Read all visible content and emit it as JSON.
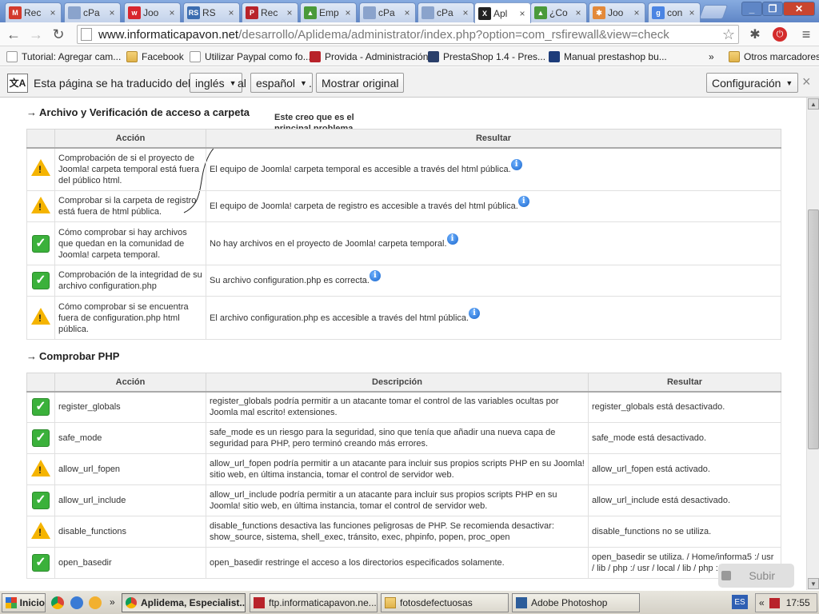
{
  "browser": {
    "tabs": [
      {
        "title": "Rec",
        "icon": "gmail-icon",
        "color": "#d33a2c",
        "glyph": "M"
      },
      {
        "title": "cPa",
        "icon": "page-icon",
        "color": "#8aa3cc",
        "glyph": ""
      },
      {
        "title": "Joo",
        "icon": "joomla-icon",
        "color": "#d8262e",
        "glyph": "w"
      },
      {
        "title": "RS",
        "icon": "rsfirewall-icon",
        "color": "#3c6db0",
        "glyph": "RS"
      },
      {
        "title": "Rec",
        "icon": "provida-icon",
        "color": "#b8232a",
        "glyph": "P"
      },
      {
        "title": "Emp",
        "icon": "drive-icon",
        "color": "#4a9a3a",
        "glyph": "▲"
      },
      {
        "title": "cPa",
        "icon": "page-icon",
        "color": "#8aa3cc",
        "glyph": ""
      },
      {
        "title": "cPa",
        "icon": "page-icon",
        "color": "#8aa3cc",
        "glyph": ""
      },
      {
        "title": "Apl",
        "icon": "joomla-icon",
        "color": "#222222",
        "glyph": "X"
      },
      {
        "title": "¿Co",
        "icon": "drive-icon",
        "color": "#4a9a3a",
        "glyph": "▲"
      },
      {
        "title": "Joo",
        "icon": "joomla-icon",
        "color": "#e3893a",
        "glyph": "✱"
      },
      {
        "title": "con",
        "icon": "google-icon",
        "color": "#4a84e3",
        "glyph": "g"
      }
    ],
    "close_glyph": "×",
    "url_host": "www.informaticapavon.net",
    "url_path": "/desarrollo/Aplidema/administrator/index.php?option=com_rsfirewall&view=check",
    "nav": {
      "back": "←",
      "forward": "→",
      "reload": "↻",
      "star": "☆",
      "menu": "≡"
    }
  },
  "bookmarks": [
    {
      "label": "Tutorial: Agregar cam...",
      "icon": "page-icon"
    },
    {
      "label": "Facebook",
      "icon": "folder-icon"
    },
    {
      "label": "Utilizar Paypal como fo...",
      "icon": "page-icon"
    },
    {
      "label": "Provida - Administración",
      "icon": "provida-icon"
    },
    {
      "label": "PrestaShop 1.4 - Pres...",
      "icon": "prestashop-icon"
    },
    {
      "label": "Manual prestashop bu...",
      "icon": "scribd-icon"
    }
  ],
  "bookmarks_overflow": "»",
  "other_bookmarks": "Otros marcadores",
  "translate": {
    "text": "Esta página se ha traducido del",
    "from_lang": "inglés",
    "al": "al",
    "to_lang": "español",
    "period": ".",
    "show_original": "Mostrar original",
    "config": "Configuración",
    "close": "×"
  },
  "annotation": "Este creo que es el\nprincipal problema",
  "section1": {
    "arrow": "→",
    "title": "Archivo y Verificación de acceso a carpeta",
    "col_action": "Acción",
    "col_result": "Resultar",
    "rows": [
      {
        "status": "warning",
        "action": "Comprobación de si el proyecto de Joomla! carpeta temporal está fuera del público html.",
        "result": "El equipo de Joomla! carpeta temporal es accesible a través del html pública."
      },
      {
        "status": "warning",
        "action": "Comprobar si la carpeta de registro está fuera de html pública.",
        "result": "El equipo de Joomla! carpeta de registro es accesible a través del html pública."
      },
      {
        "status": "ok",
        "action": "Cómo comprobar si hay archivos que quedan en la comunidad de Joomla! carpeta temporal.",
        "result": "No hay archivos en el proyecto de Joomla! carpeta temporal."
      },
      {
        "status": "ok",
        "action": "Comprobación de la integridad de su archivo configuration.php",
        "result": "Su archivo configuration.php es correcta."
      },
      {
        "status": "warning",
        "action": "Cómo comprobar si se encuentra fuera de configuration.php html pública.",
        "result": "El archivo configuration.php es accesible a través del html pública."
      }
    ]
  },
  "section2": {
    "arrow": "→",
    "title": "Comprobar PHP",
    "col_action": "Acción",
    "col_desc": "Descripción",
    "col_result": "Resultar",
    "rows": [
      {
        "status": "ok",
        "action": "register_globals",
        "desc": "register_globals podría permitir a un atacante tomar el control de las variables ocultas por Joomla mal escrito! extensiones.",
        "result": "register_globals está desactivado."
      },
      {
        "status": "ok",
        "action": "safe_mode",
        "desc": "safe_mode es un riesgo para la seguridad, sino que tenía que añadir una nueva capa de seguridad para PHP, pero terminó creando más errores.",
        "result": "safe_mode está desactivado."
      },
      {
        "status": "warning",
        "action": "allow_url_fopen",
        "desc": "allow_url_fopen podría permitir a un atacante para incluir sus propios scripts PHP en su Joomla! sitio web, en última instancia, tomar el control de servidor web.",
        "result": "allow_url_fopen está activado."
      },
      {
        "status": "ok",
        "action": "allow_url_include",
        "desc": "allow_url_include podría permitir a un atacante para incluir sus propios scripts PHP en su Joomla! sitio web, en última instancia, tomar el control de servidor web.",
        "result": "allow_url_include está desactivado."
      },
      {
        "status": "warning",
        "action": "disable_functions",
        "desc": "disable_functions desactiva las funciones peligrosas de PHP. Se recomienda desactivar: show_source, sistema, shell_exec, tránsito, exec, phpinfo, popen, proc_open",
        "result": "disable_functions no se utiliza."
      },
      {
        "status": "ok",
        "action": "open_basedir",
        "desc": "open_basedir restringe el acceso a los directorios especificados solamente.",
        "result": "open_basedir se utiliza. / Home/informa5 :/ usr / lib / php :/ usr / local / lib / php :/ tmp"
      }
    ]
  },
  "subir": "Subir",
  "taskbar": {
    "start": "Inicio",
    "tasks": [
      {
        "label": "Aplidema, Especialist...",
        "icon": "chrome-icon",
        "active": true
      },
      {
        "label": "ftp.informaticapavon.ne...",
        "icon": "filezilla-icon",
        "active": false
      },
      {
        "label": "fotosdefectuosas",
        "icon": "folder-icon",
        "active": false
      },
      {
        "label": "Adobe Photoshop",
        "icon": "photoshop-icon",
        "active": false
      }
    ],
    "overflow": "»",
    "lang": "ES",
    "tray_overflow": "«",
    "clock": "17:55"
  }
}
